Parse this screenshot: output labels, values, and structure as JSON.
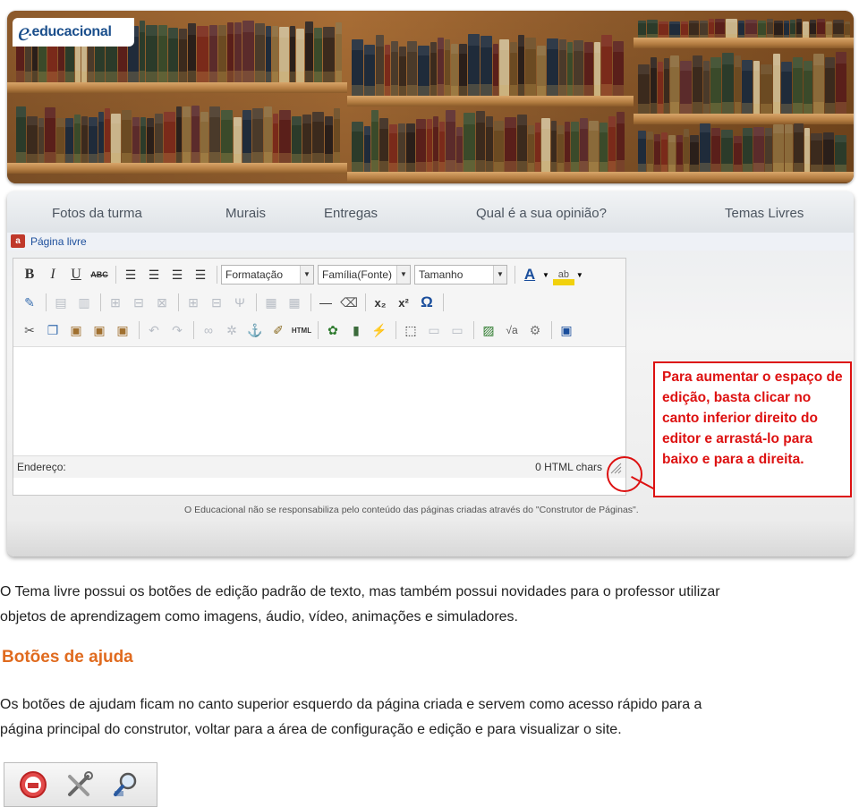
{
  "logo": {
    "letter": "e",
    "text": ".educacional"
  },
  "nav": [
    "Fotos da turma",
    "Murais",
    "Entregas",
    "Qual é a sua opinião?",
    "Temas Livres"
  ],
  "page_label": "Página livre",
  "toolbar": {
    "bold": "B",
    "italic": "I",
    "underline": "U",
    "strike": "ABC",
    "format": "Formatação",
    "font": "Família(Fonte)",
    "size": "Tamanho",
    "font_color": "A",
    "highlight": "ab",
    "sub": "x₂",
    "sup": "x²",
    "omega": "Ω",
    "html": "HTML"
  },
  "status": {
    "address": "Endereço:",
    "chars": "0 HTML chars"
  },
  "callout": "Para aumentar o espaço de edição, basta clicar no canto inferior direito do editor e arrastá-lo para baixo e para a direita.",
  "disclaimer": "O Educacional não se responsabiliza pelo conteúdo das páginas criadas através do \"Construtor de Páginas\".",
  "doc": {
    "para1_line1": " O Tema livre possui os botões de edição padrão de texto, mas também possui novidades para o professor utilizar",
    "para1_line2": "objetos de aprendizagem como imagens, áudio, vídeo, animações e simuladores.",
    "heading": "Botões de ajuda",
    "para2_line1": "Os botões de ajudam ficam no canto superior esquerdo da página criada e servem como acesso rápido para a",
    "para2_line2": "página principal do construtor, voltar para a área de configuração e edição e para visualizar o site."
  },
  "help_icons": [
    "home-icon",
    "tools-icon",
    "magnifier-icon"
  ],
  "colors": {
    "accent_orange": "#e06b1f",
    "callout_red": "#dd1111",
    "link_blue": "#1d4f9c"
  }
}
